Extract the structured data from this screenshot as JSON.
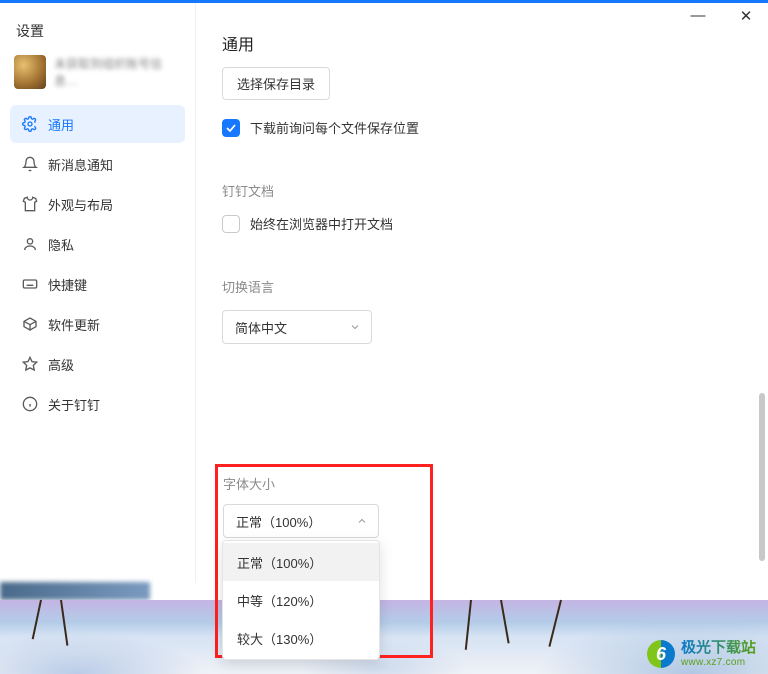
{
  "window": {
    "title": "设置",
    "account_status": "未获取到组织账号信息…",
    "minimize": "—",
    "close": "✕"
  },
  "sidebar": {
    "items": [
      {
        "label": "通用"
      },
      {
        "label": "新消息通知"
      },
      {
        "label": "外观与布局"
      },
      {
        "label": "隐私"
      },
      {
        "label": "快捷键"
      },
      {
        "label": "软件更新"
      },
      {
        "label": "高级"
      },
      {
        "label": "关于钉钉"
      }
    ]
  },
  "general": {
    "heading": "通用",
    "choose_dir_btn": "选择保存目录",
    "ask_location_label": "下载前询问每个文件保存位置"
  },
  "docs": {
    "heading": "钉钉文档",
    "open_in_browser_label": "始终在浏览器中打开文档"
  },
  "language": {
    "heading": "切换语言",
    "selected": "简体中文"
  },
  "fontsize": {
    "heading": "字体大小",
    "selected": "正常（100%）",
    "options": [
      "正常（100%）",
      "中等（120%）",
      "较大（130%）"
    ]
  },
  "watermark": {
    "name": "极光下载站",
    "url": "www.xz7.com",
    "glyph": "6"
  }
}
